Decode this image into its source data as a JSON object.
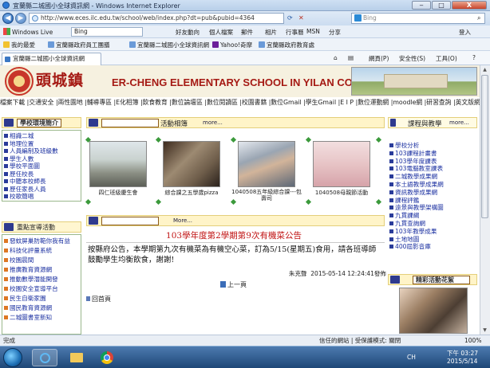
{
  "window": {
    "title": "宜蘭縣二城國小全球資訊網 - Windows Internet Explorer",
    "min": "‒",
    "max": "□",
    "close": "X"
  },
  "address": {
    "url": "http://www.eces.ilc.edu.tw/school/web/index.php?dt=pub&pubid=4364",
    "search_placeholder": "Bing"
  },
  "menubar": {
    "live": "Windows Live",
    "live_search": "Bing",
    "items": [
      "好友動向",
      "個人檔案",
      "郵件",
      "相片",
      "行事曆",
      "MSN",
      "分享"
    ],
    "signin": "登入"
  },
  "favbar": {
    "fav": "我的最愛",
    "links": [
      "宜蘭縣政府員工團膳",
      "宜蘭縣二城國小全球資訊網",
      "Yahoo!奇摩",
      "宜蘭縣政府教育處"
    ]
  },
  "tab": {
    "label": "宜蘭縣二城國小全球資訊網",
    "commands": [
      "網頁(P)",
      "安全性(S)",
      "工具(O)"
    ]
  },
  "banner": {
    "name_cn": "頭城鎮",
    "name_en": "ER-CHENG ELEMENTARY SCHOOL IN YILAN COUNTY"
  },
  "topnav": "檔案下載 |交通安全 |兩性園地 |輔導專區 |E化相簿 |飲食教育 |數位論壇區 |數位閱讀區 |校園書籍 |數位Gmail |學生Gmail |E I P |數位運動網 |moodle網 |研習查詢 |英文版網",
  "left": {
    "intro": {
      "title": "學校環境簡介",
      "items": [
        "相識二城",
        "地理位置",
        "人員編制及班級數",
        "學生人數",
        "學校平面圖",
        "歷任校長",
        "中聽本校師長",
        "歷任家長人員",
        "校歌簡唱"
      ]
    },
    "promo": {
      "title": "重點宣導活動",
      "items": [
        "惡蚊屏巢防範你我有益",
        "科技化評量系統",
        "校園晨間",
        "推廣教育資源網",
        "推動數學潛能開發",
        "校園安全宣導平台",
        "民生自衛家園",
        "國民教育資源網",
        "二城圖書室新知"
      ]
    }
  },
  "news": {
    "title": "活動相簿",
    "more": "more...",
    "photos": [
      {
        "caption": "四仁班級慶生會"
      },
      {
        "caption": "綜合課之五學歲pizza"
      },
      {
        "caption": "1040508五年級綜合課---包壽司"
      },
      {
        "caption": "1040508母親節活動"
      }
    ]
  },
  "announce": {
    "header_more": "More...",
    "title": "103學年度第2學期第9次有機菜公告",
    "body": "按縣府公告，本學期第九次有機菜為有機空心菜，訂為5/15(星期五)食用，請各班導師鼓勵學生均衡飲食，謝謝!",
    "poster": "朱克聲",
    "date": "2015-05-14 12:24:41發佈",
    "prev": "上一頁",
    "home": "回首頁"
  },
  "right": {
    "title": "課程與教學",
    "more": "more...",
    "items": [
      "學校分析",
      "103課程計畫書",
      "103學年度課表",
      "103電腦教室課表",
      "二城教學成果網",
      "本土語教學成果網",
      "資訊教學成果網",
      "課程評鑑",
      "遠景與教學架構圖",
      "九貫課綱",
      "九貫查詢網",
      "103年教學成果",
      "土地地圖",
      "400屆影音庫"
    ],
    "photo_title": "精彩活動花絮"
  },
  "status": {
    "left": "完成",
    "zone": "信任的網站 | 受保護模式: 關閉",
    "zoom": "100%"
  },
  "taskbar": {
    "lang": "CH",
    "time": "下午 03:27",
    "date": "2015/5/14"
  }
}
